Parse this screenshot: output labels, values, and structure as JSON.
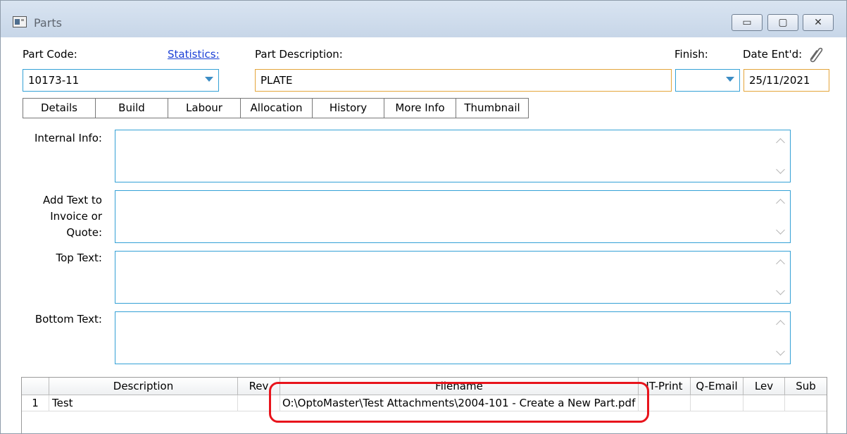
{
  "window": {
    "title": "Parts",
    "controls": {
      "minimize": "▭",
      "restore": "▢",
      "close": "✕"
    }
  },
  "header": {
    "part_code_label": "Part Code:",
    "part_code_value": "10173-11",
    "statistics_link": "Statistics:",
    "part_description_label": "Part Description:",
    "part_description_value": "PLATE",
    "finish_label": "Finish:",
    "finish_value": "",
    "date_entered_label": "Date Ent'd:",
    "date_entered_value": "25/11/2021"
  },
  "tabs": [
    "Details",
    "Build",
    "Labour",
    "Allocation",
    "History",
    "More Info",
    "Thumbnail"
  ],
  "details": {
    "internal_info_label": "Internal Info:",
    "add_text_label_lines": [
      "Add Text to",
      "Invoice or",
      "Quote:"
    ],
    "top_text_label": "Top Text:",
    "bottom_text_label": "Bottom Text:"
  },
  "attachments": {
    "columns": [
      "",
      "Description",
      "Rev",
      "Filename",
      "IT-Print",
      "Q-Email",
      "Lev",
      "Sub"
    ],
    "rows": [
      [
        "1",
        "Test",
        "",
        "O:\\OptoMaster\\Test Attachments\\2004-101 - Create a New Part.pdf",
        "",
        "",
        "",
        ""
      ]
    ]
  },
  "colors": {
    "field_border": "#34a1d6",
    "required_border": "#e4a53b",
    "highlight": "#e8141c",
    "link": "#1a3fd6"
  }
}
